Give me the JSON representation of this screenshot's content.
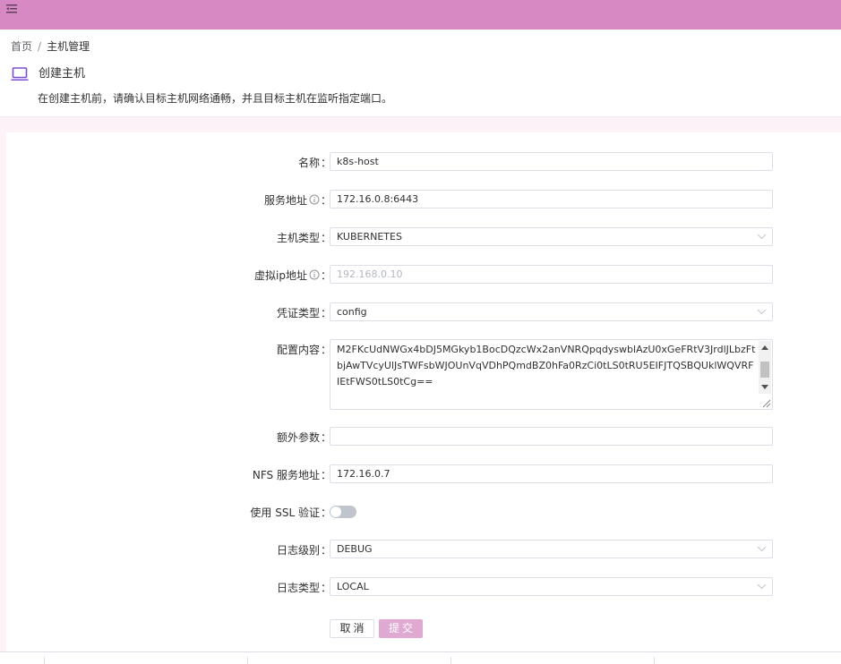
{
  "theme": {
    "accent": "#d789c4",
    "submit_bg": "#e0a9d2",
    "icon_color": "#7b4fd6"
  },
  "header": {
    "menu_icon": "menu-fold-icon"
  },
  "breadcrumb": {
    "home": "首页",
    "separator": "/",
    "current": "主机管理"
  },
  "page": {
    "title_icon": "laptop-icon",
    "title": "创建主机",
    "description": "在创建主机前，请确认目标主机网络通畅，并且目标主机在监听指定端口。"
  },
  "form": {
    "colon": "：",
    "name": {
      "label": "名称",
      "value": "k8s-host"
    },
    "service_address": {
      "label": "服务地址",
      "value": "172.16.0.8:6443",
      "icon": "info-circle-icon"
    },
    "host_type": {
      "label": "主机类型",
      "value": "KUBERNETES"
    },
    "virtual_ip": {
      "label": "虚拟ip地址",
      "value": "",
      "placeholder": "192.168.0.10",
      "icon": "info-circle-icon"
    },
    "credential_type": {
      "label": "凭证类型",
      "value": "config"
    },
    "config_content": {
      "label": "配置内容",
      "value": "M2FKcUdNWGx4bDJ5MGkyb1BocDQzcWx2anVNRQpqdyswblAzU0xGeFRtV3JrdlJLbzFtbjAwTVcyUlJsTWFsbWJOUnVqVDhPQmdBZ0hFa0RzCi0tLS0tRU5EIFJTQSBQUklWQVRFIEtFWS0tLS0tCg=="
    },
    "extra_params": {
      "label": "额外参数",
      "value": ""
    },
    "nfs_address": {
      "label": "NFS 服务地址",
      "value": "172.16.0.7"
    },
    "use_ssl": {
      "label": "使用 SSL 验证",
      "enabled": false
    },
    "log_level": {
      "label": "日志级别",
      "value": "DEBUG"
    },
    "log_type": {
      "label": "日志类型",
      "value": "LOCAL"
    }
  },
  "buttons": {
    "cancel": "取消",
    "submit": "提交"
  }
}
